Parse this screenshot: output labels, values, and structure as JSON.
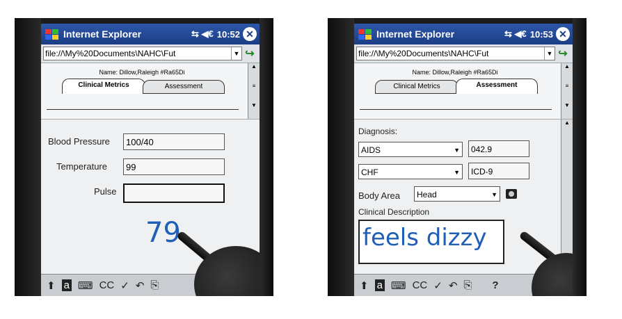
{
  "left": {
    "titlebar": {
      "title": "Internet Explorer",
      "status_icons": "⇆ ◀€",
      "time": "10:52",
      "close": "✕"
    },
    "address": {
      "value": "file://\\My%20Documents\\NAHC\\Fut"
    },
    "header": {
      "name": "Name: Dillow,Raleigh #Ra65Di"
    },
    "tabs": [
      {
        "label": "Clinical Metrics",
        "active": true
      },
      {
        "label": "Assessment",
        "active": false
      }
    ],
    "fields": {
      "bp_label": "Blood Pressure",
      "bp_value": "100/40",
      "temp_label": "Temperature",
      "temp_value": "99",
      "pulse_label": "Pulse",
      "pulse_value": ""
    },
    "ink_text": "79",
    "toolbar": [
      "⬆",
      "a",
      "⌨",
      "CC",
      "✓",
      "↶",
      "⎘"
    ]
  },
  "right": {
    "titlebar": {
      "title": "Internet Explorer",
      "status_icons": "⇆ ◀€",
      "time": "10:53",
      "close": "✕"
    },
    "address": {
      "value": "file://\\My%20Documents\\NAHC\\Fut"
    },
    "header": {
      "name": "Name: Dillow,Raleigh #Ra65Di"
    },
    "tabs": [
      {
        "label": "Clinical Metrics",
        "active": false
      },
      {
        "label": "Assessment",
        "active": true
      }
    ],
    "fields": {
      "diag_label": "Diagnosis:",
      "diag1_select": "AIDS",
      "diag1_code": "042.9",
      "diag2_select": "CHF",
      "diag2_code": "ICD-9",
      "body_label": "Body Area",
      "body_select": "Head",
      "clin_label": "Clinical Description"
    },
    "ink_text": "feels dizzy",
    "toolbar": [
      "⬆",
      "a",
      "⌨",
      "CC",
      "✓",
      "↶",
      "⎘",
      "?"
    ]
  },
  "colors": {
    "titlebar": "#1c3d86",
    "ink": "#1f5fb8",
    "bezel": "#1b1b1b"
  }
}
